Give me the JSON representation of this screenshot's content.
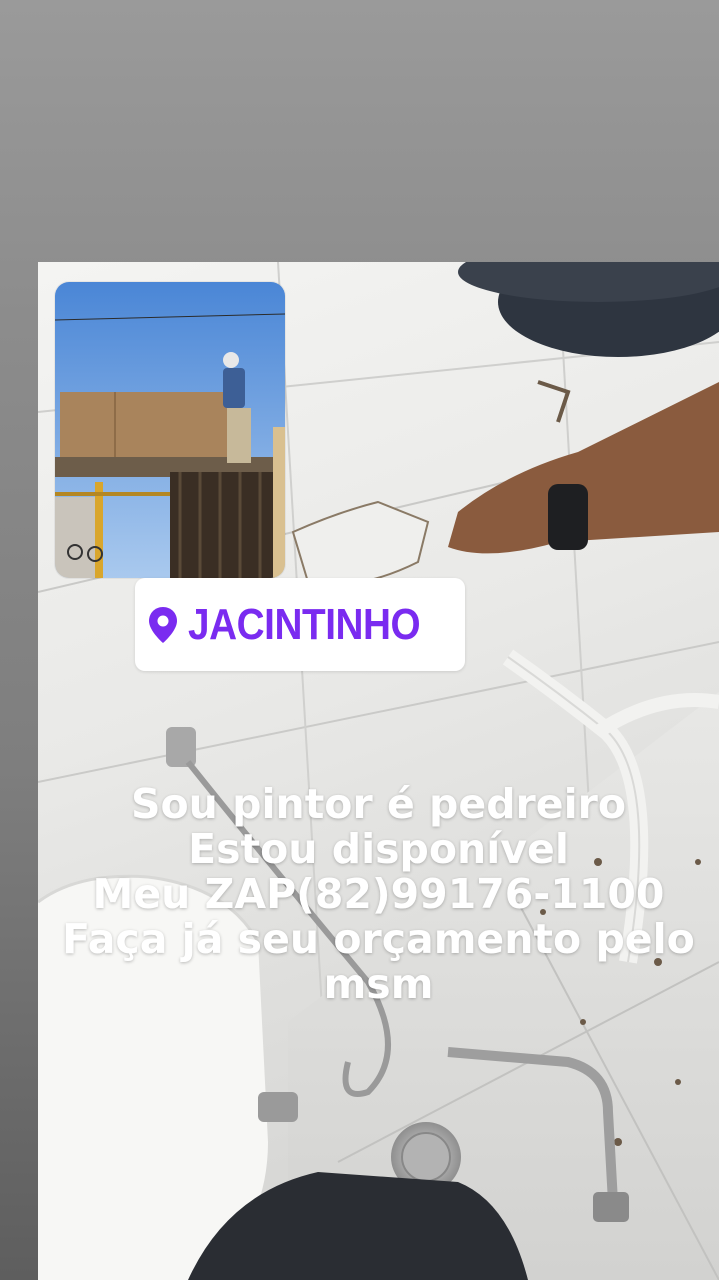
{
  "location_sticker": {
    "icon": "location-pin-icon",
    "label": "JACINTINHO",
    "color": "#7a2bf0"
  },
  "caption": {
    "lines": [
      "Sou pintor é pedreiro",
      "Estou disponível",
      "Meu ZAP(82)99176-1100",
      "Faça já seu orçamento pelo",
      "msm"
    ],
    "color": "#ffffff"
  }
}
